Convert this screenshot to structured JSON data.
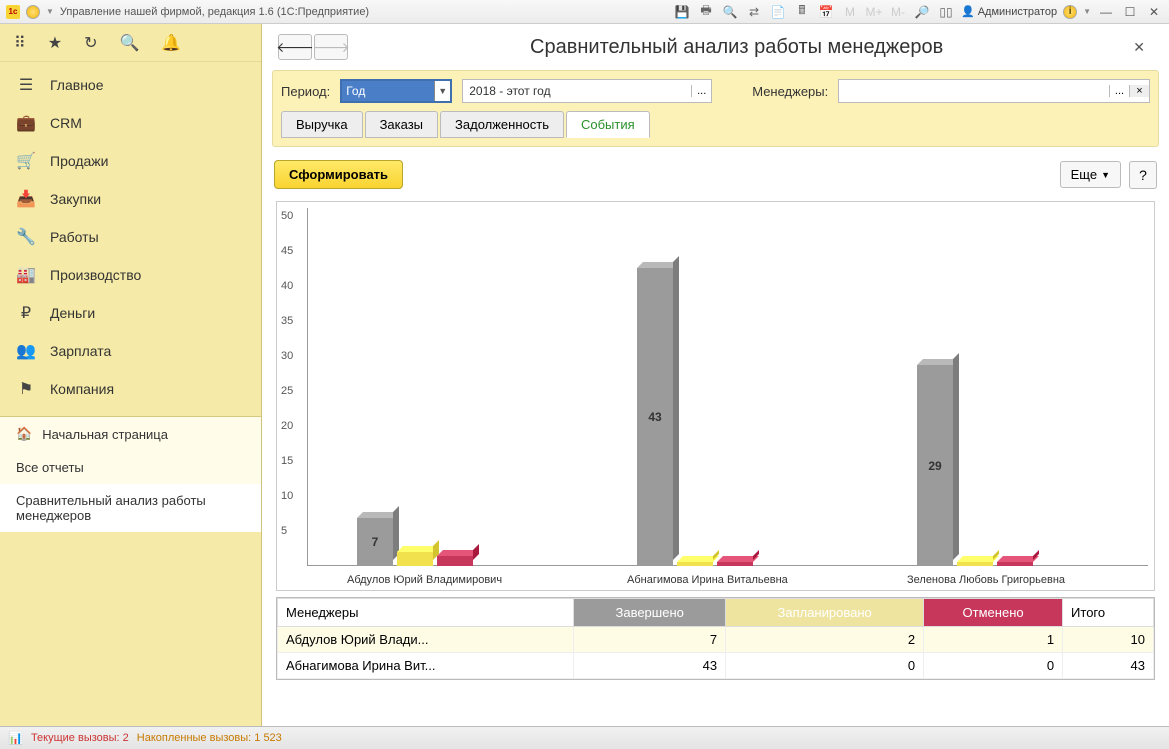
{
  "window": {
    "title": "Управление нашей фирмой, редакция 1.6  (1С:Предприятие)",
    "user": "Администратор"
  },
  "sidebar": {
    "items": [
      {
        "icon": "☰",
        "label": "Главное"
      },
      {
        "icon": "💼",
        "label": "CRM"
      },
      {
        "icon": "🛒",
        "label": "Продажи"
      },
      {
        "icon": "📥",
        "label": "Закупки"
      },
      {
        "icon": "🔧",
        "label": "Работы"
      },
      {
        "icon": "🏭",
        "label": "Производство"
      },
      {
        "icon": "₽",
        "label": "Деньги"
      },
      {
        "icon": "👥",
        "label": "Зарплата"
      },
      {
        "icon": "⚑",
        "label": "Компания"
      }
    ],
    "home_label": "Начальная страница",
    "sub1": "Все отчеты",
    "sub2": "Сравнительный анализ работы менеджеров"
  },
  "page": {
    "title": "Сравнительный анализ работы менеджеров",
    "period_label": "Период:",
    "period_type": "Год",
    "period_text": "2018 - этот год",
    "managers_label": "Менеджеры:",
    "managers_value": "",
    "tabs": [
      "Выручка",
      "Заказы",
      "Задолженность",
      "События"
    ],
    "active_tab": 3,
    "generate_btn": "Сформировать",
    "more_btn": "Еще",
    "help_btn": "?"
  },
  "chart_data": {
    "type": "bar",
    "categories": [
      "Абдулов Юрий Владимирович",
      "Абнагимова Ирина Витальевна",
      "Зеленова Любовь Григорьевна"
    ],
    "series": [
      {
        "name": "Завершено",
        "color": "#9b9b9b",
        "values": [
          7,
          43,
          29
        ]
      },
      {
        "name": "Запланировано",
        "color": "#f1e24d",
        "values": [
          2,
          0,
          0
        ]
      },
      {
        "name": "Отменено",
        "color": "#c7365b",
        "values": [
          1,
          0,
          0
        ]
      }
    ],
    "ylim": [
      0,
      50
    ],
    "yticks": [
      5,
      10,
      15,
      20,
      25,
      30,
      35,
      40,
      45,
      50
    ]
  },
  "table": {
    "headers": [
      "Менеджеры",
      "Завершено",
      "Запланировано",
      "Отменено",
      "Итого"
    ],
    "rows": [
      {
        "name": "Абдулов Юрий Влади...",
        "vals": [
          7,
          2,
          1,
          10
        ],
        "hl": true
      },
      {
        "name": "Абнагимова Ирина Вит...",
        "vals": [
          43,
          0,
          0,
          43
        ],
        "hl": false
      }
    ]
  },
  "status": {
    "calls_current_label": "Текущие вызовы:",
    "calls_current": "2",
    "calls_total_label": "Накопленные вызовы:",
    "calls_total": "1 523"
  }
}
